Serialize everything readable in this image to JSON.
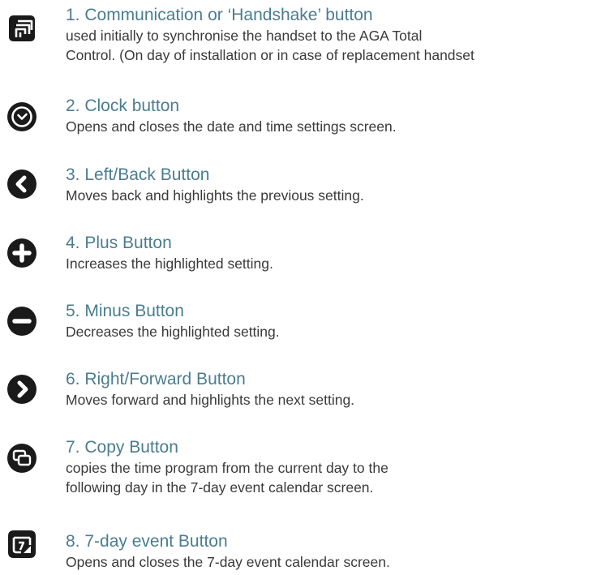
{
  "items": [
    {
      "icon": "handshake-icon",
      "title": "1. Communication or ‘Handshake’ button",
      "desc_line1": "used initially to synchronise the handset to the AGA Total",
      "desc_line2": "Control. (On day of installation or in case of replacement handset"
    },
    {
      "icon": "clock-icon",
      "title": "2. Clock button",
      "desc_line1": "Opens and closes the date and time settings screen."
    },
    {
      "icon": "chevron-left-icon",
      "title": "3. Left/Back Button",
      "desc_line1": "Moves back and highlights the previous setting."
    },
    {
      "icon": "plus-icon",
      "title": "4. Plus Button",
      "desc_line1": "Increases the highlighted setting."
    },
    {
      "icon": "minus-icon",
      "title": "5. Minus Button",
      "desc_line1": "Decreases the highlighted setting."
    },
    {
      "icon": "chevron-right-icon",
      "title": "6. Right/Forward Button",
      "desc_line1": "Moves forward and highlights the next setting."
    },
    {
      "icon": "copy-icon",
      "title": "7. Copy Button",
      "desc_line1": "copies the time program from the current day to the",
      "desc_line2": "following day in the 7-day event calendar screen."
    },
    {
      "icon": "calendar-7-day-icon",
      "title": "8. 7-day event Button",
      "desc_line1": "Opens and closes the 7-day event calendar screen."
    }
  ],
  "colors": {
    "title": "#4a7d8f",
    "body": "#3a3a3a",
    "icon": "#1a1a1a"
  }
}
